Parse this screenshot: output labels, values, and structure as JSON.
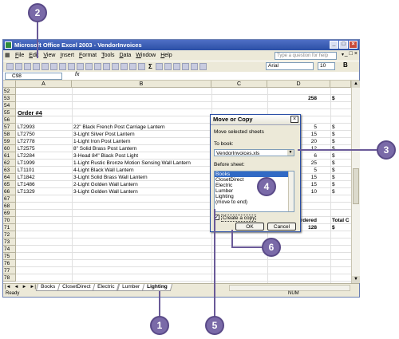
{
  "window": {
    "title": "Microsoft Office Excel 2003 - VendorInvoices",
    "controls": [
      "_",
      "□",
      "×"
    ]
  },
  "menu": [
    "File",
    "Edit",
    "View",
    "Insert",
    "Format",
    "Tools",
    "Data",
    "Window",
    "Help"
  ],
  "help_placeholder": "Type a question for help",
  "mdi_controls": [
    "_",
    "□",
    "×"
  ],
  "toolbar": {
    "font": "Arial",
    "size": "10",
    "bold": "B",
    "sum": "Σ"
  },
  "formula_bar": {
    "name_box": "C98",
    "fx": "fx"
  },
  "columns": [
    "A",
    "B",
    "C",
    "D"
  ],
  "rows": [
    {
      "n": "52",
      "a": "",
      "b": "",
      "d": "",
      "e": ""
    },
    {
      "n": "53",
      "a": "",
      "b": "",
      "d": "258",
      "e": "$"
    },
    {
      "n": "54",
      "a": "",
      "b": "",
      "d": "",
      "e": ""
    },
    {
      "n": "55",
      "a": "Order #4",
      "b": "",
      "d": "",
      "e": ""
    },
    {
      "n": "56",
      "a": "",
      "b": "",
      "d": "",
      "e": ""
    },
    {
      "n": "57",
      "a": "LT2993",
      "b": "22\" Black French Post Carriage Lantern",
      "d": "5",
      "e": "$"
    },
    {
      "n": "58",
      "a": "LT2750",
      "b": "3-Light Silver Post Lantern",
      "d": "15",
      "e": "$"
    },
    {
      "n": "59",
      "a": "LT2778",
      "b": "1-Light Iron Post Lantern",
      "d": "20",
      "e": "$"
    },
    {
      "n": "60",
      "a": "LT2575",
      "b": "8\" Solid Brass Post Lantern",
      "d": "12",
      "e": "$"
    },
    {
      "n": "61",
      "a": "LT2284",
      "b": "3-Head 84\" Black Post Light",
      "d": "6",
      "e": "$"
    },
    {
      "n": "62",
      "a": "LT1999",
      "b": "1-Light Rustic Bronze Motion Sensing Wall Lantern",
      "d": "25",
      "e": "$"
    },
    {
      "n": "63",
      "a": "LT1101",
      "b": "4-Light Black Wall Lantern",
      "d": "5",
      "e": "$"
    },
    {
      "n": "64",
      "a": "LT1842",
      "b": "3-Light Solid Brass Wall Lantern",
      "d": "15",
      "e": "$"
    },
    {
      "n": "65",
      "a": "LT1486",
      "b": "2-Light Golden Wall Lantern",
      "d": "15",
      "e": "$"
    },
    {
      "n": "66",
      "a": "LT1329",
      "b": "3-Light Golden Wall Lantern",
      "d": "10",
      "e": "$"
    },
    {
      "n": "67",
      "a": "",
      "b": "",
      "d": "",
      "e": ""
    },
    {
      "n": "68",
      "a": "",
      "b": "",
      "d": "",
      "e": ""
    },
    {
      "n": "69",
      "a": "",
      "b": "",
      "d": "",
      "e": ""
    },
    {
      "n": "70",
      "a": "",
      "b": "",
      "d": "Ordered",
      "e": "Total C"
    },
    {
      "n": "71",
      "a": "",
      "b": "",
      "d": "128",
      "e": "$"
    },
    {
      "n": "72",
      "a": "",
      "b": "",
      "d": "",
      "e": ""
    },
    {
      "n": "73",
      "a": "",
      "b": "",
      "d": "",
      "e": ""
    },
    {
      "n": "74",
      "a": "",
      "b": "",
      "d": "",
      "e": ""
    },
    {
      "n": "75",
      "a": "",
      "b": "",
      "d": "",
      "e": ""
    },
    {
      "n": "76",
      "a": "",
      "b": "",
      "d": "",
      "e": ""
    },
    {
      "n": "77",
      "a": "",
      "b": "",
      "d": "",
      "e": ""
    },
    {
      "n": "78",
      "a": "",
      "b": "",
      "d": "",
      "e": ""
    }
  ],
  "sheet_tabs": [
    "Books",
    "ClosetDirect",
    "Electric",
    "Lumber",
    "Lighting"
  ],
  "active_tab": "Lighting",
  "tab_nav": [
    "|◄",
    "◄",
    "►",
    "►|"
  ],
  "status": {
    "left": "Ready",
    "right": "NUM"
  },
  "dialog": {
    "title": "Move or Copy",
    "close": "×",
    "subtitle": "Move selected sheets",
    "to_book_label": "To book:",
    "to_book_value": "VendorInvoices.xls",
    "before_sheet_label": "Before sheet:",
    "sheets": [
      "Books",
      "ClosetDirect",
      "Electric",
      "Lumber",
      "Lighting",
      "(move to end)"
    ],
    "selected_sheet": "Books",
    "create_copy_label": "Create a copy",
    "create_copy_checked": "✓",
    "ok": "OK",
    "cancel": "Cancel"
  },
  "callouts": [
    "1",
    "2",
    "3",
    "4",
    "5",
    "6"
  ],
  "colors": {
    "callout": "#7a6aa8",
    "titlebar": "#2b4fa6",
    "selection": "#316ac5"
  }
}
